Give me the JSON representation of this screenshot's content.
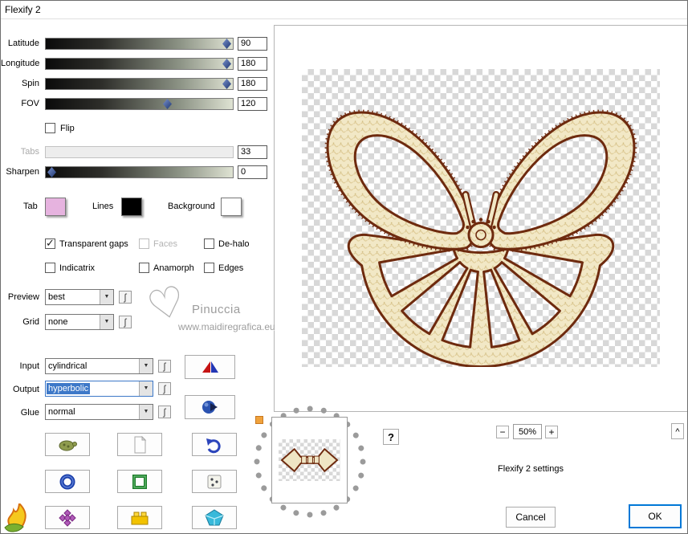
{
  "window": {
    "title": "Flexify 2"
  },
  "sliders": {
    "latitude": {
      "label": "Latitude",
      "value": "90"
    },
    "longitude": {
      "label": "Longitude",
      "value": "180"
    },
    "spin": {
      "label": "Spin",
      "value": "180"
    },
    "fov": {
      "label": "FOV",
      "value": "120"
    },
    "tabs": {
      "label": "Tabs",
      "value": "33"
    },
    "sharpen": {
      "label": "Sharpen",
      "value": "0"
    }
  },
  "checkboxes": {
    "flip": {
      "label": "Flip",
      "checked": false
    },
    "transparent_gaps": {
      "label": "Transparent gaps",
      "checked": true
    },
    "faces": {
      "label": "Faces",
      "checked": false,
      "disabled": true
    },
    "dehalo": {
      "label": "De-halo",
      "checked": false
    },
    "indicatrix": {
      "label": "Indicatrix",
      "checked": false
    },
    "anamorph": {
      "label": "Anamorph",
      "checked": false
    },
    "edges": {
      "label": "Edges",
      "checked": false
    }
  },
  "swatches": {
    "tab": {
      "label": "Tab",
      "color": "#e6b3df"
    },
    "lines": {
      "label": "Lines",
      "color": "#000000"
    },
    "background": {
      "label": "Background",
      "color": "#ffffff"
    }
  },
  "dropdowns": {
    "preview": {
      "label": "Preview",
      "value": "best"
    },
    "grid": {
      "label": "Grid",
      "value": "none"
    },
    "input": {
      "label": "Input",
      "value": "cylindrical"
    },
    "output": {
      "label": "Output",
      "value": "hyperbolic",
      "selected": true
    },
    "glue": {
      "label": "Glue",
      "value": "normal"
    }
  },
  "ui": {
    "check_glyph": "✓",
    "arrow_glyph": "▼",
    "reset_glyph": "ʃ",
    "help_label": "?"
  },
  "zoom": {
    "minus": "−",
    "level": "50%",
    "plus": "+",
    "collapse": "^"
  },
  "footer": {
    "settings_label": "Flexify 2 settings",
    "cancel_label": "Cancel",
    "ok_label": "OK"
  },
  "watermark": {
    "heart": "♡",
    "name": "Pinuccia",
    "url": "www.maidiregrafica.eu"
  },
  "icons": {
    "reset": "curved-s-reset",
    "dropdown_arrow": "triangle-down",
    "input_action": "red-blue-pinwheel",
    "output_action": "blue-sphere-arrow",
    "turtle": "green-turtle",
    "page": "blank-page",
    "undo": "blue-curved-arrow",
    "ring": "blue-ring",
    "frame": "green-square-frame",
    "dice": "dice",
    "flame": "flaming-pear-logo",
    "flower": "purple-flower",
    "brick": "yellow-brick",
    "gem": "blue-gem"
  },
  "colors": {
    "accent": "#0078d7",
    "outline_brown": "#6e2a0e",
    "fill_cream": "#f2e8c6",
    "selection_blue": "#3d78c8"
  }
}
